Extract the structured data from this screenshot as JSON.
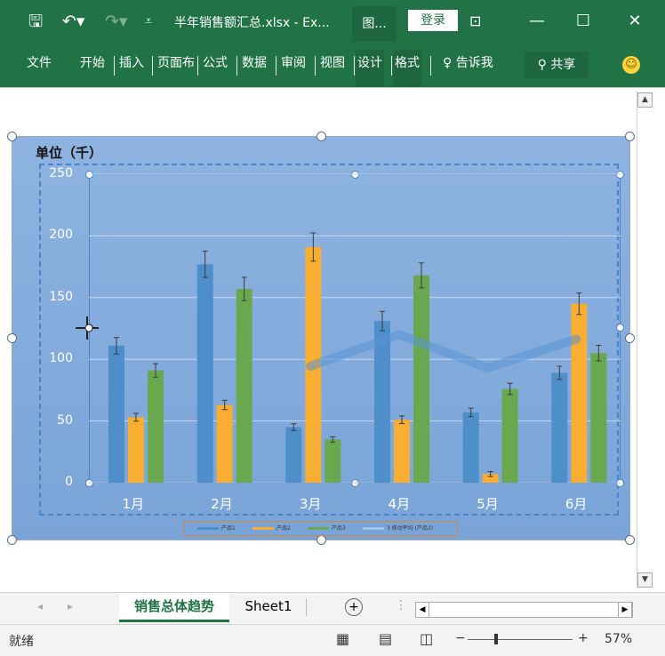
{
  "window": {
    "title": "半年销售额汇总.xlsx - Ex...",
    "context_tab": "图...",
    "login_label": "登录",
    "minimize": "—",
    "maximize": "☐",
    "close": "✕"
  },
  "ribbon": {
    "tabs": [
      "文件",
      "开始",
      "插入",
      "页面布",
      "公式",
      "数据",
      "审阅",
      "视图",
      "设计",
      "格式"
    ],
    "tell_me": "告诉我",
    "share": "共享"
  },
  "chart_data": {
    "type": "bar",
    "title": "",
    "unit_label": "单位（千）",
    "categories": [
      "1月",
      "2月",
      "3月",
      "4月",
      "5月",
      "6月"
    ],
    "ylim": [
      0,
      250
    ],
    "yticks": [
      0,
      50,
      100,
      150,
      200,
      250
    ],
    "grid": true,
    "legend_position": "bottom",
    "series": [
      {
        "name": "产品1",
        "color": "#4e8ecb",
        "values": [
          111,
          177,
          45,
          131,
          57,
          89
        ]
      },
      {
        "name": "产品2",
        "color": "#f7ae32",
        "values": [
          53,
          63,
          191,
          51,
          7,
          145
        ]
      },
      {
        "name": "产品3",
        "color": "#6aa84f",
        "values": [
          91,
          157,
          35,
          168,
          76,
          105
        ]
      }
    ],
    "trendline": {
      "name": "3 移动平均 (产品3)",
      "color": "#5a93d6"
    }
  },
  "sheets": {
    "tabs": [
      "销售总体趋势",
      "Sheet1"
    ],
    "active": "销售总体趋势",
    "add": "+"
  },
  "status": {
    "ready": "就绪",
    "zoom": "57%"
  }
}
